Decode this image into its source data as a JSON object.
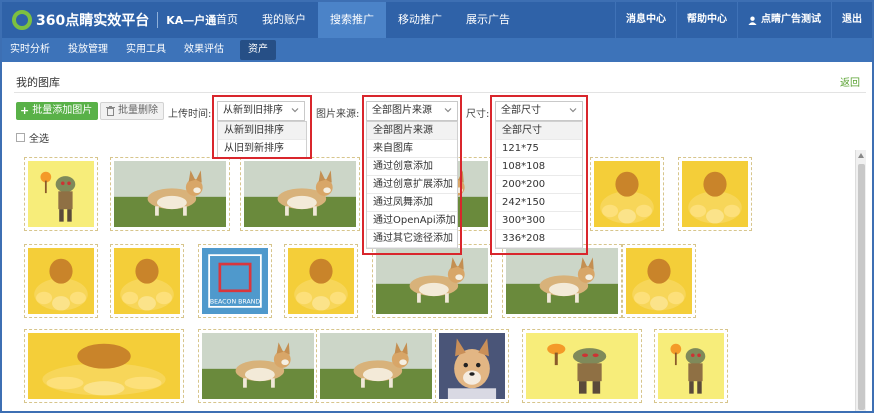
{
  "header": {
    "logo_text": "360点睛实效平台",
    "product": "KA—户通",
    "nav": [
      "首页",
      "我的账户",
      "搜索推广",
      "移动推广",
      "展示广告"
    ],
    "active_nav": "搜索推广",
    "right_nav": [
      "消息中心",
      "帮助中心",
      "点睛广告测试",
      "退出"
    ]
  },
  "subnav": {
    "items": [
      "实时分析",
      "投放管理",
      "实用工具",
      "效果评估",
      "资产"
    ],
    "active": "资产"
  },
  "page": {
    "title": "我的图库",
    "back_label": "返回"
  },
  "toolbar": {
    "batch_add_label": "批量添加图片",
    "batch_delete_label": "批量删除",
    "upload_time_label": "上传时间:",
    "upload_time_value": "从新到旧排序",
    "source_label": "图片来源:",
    "source_value": "全部图片来源",
    "size_label": "尺寸:",
    "size_value": "全部尺寸",
    "select_all_label": "全选"
  },
  "dropdowns": {
    "upload_time_options": [
      "从新到旧排序",
      "从旧到新排序"
    ],
    "source_options": [
      "全部图片来源",
      "来自图库",
      "通过创意添加",
      "通过创意扩展添加",
      "通过凤舞添加",
      "通过OpenApi添加",
      "通过其它途径添加"
    ],
    "size_options": [
      "全部尺寸",
      "121*75",
      "108*108",
      "200*200",
      "242*150",
      "300*300",
      "336*208"
    ]
  },
  "thumbnails": [
    {
      "kind": "zombie"
    },
    {
      "kind": "dog"
    },
    {
      "kind": "dog"
    },
    {
      "kind": "dog"
    },
    {
      "kind": "dog"
    },
    {
      "kind": "chick"
    },
    {
      "kind": "chick"
    },
    {
      "kind": "chick"
    },
    {
      "kind": "chick"
    },
    {
      "kind": "logo",
      "logo_text": "BEACON BRAND"
    },
    {
      "kind": "chick"
    },
    {
      "kind": "dog"
    },
    {
      "kind": "dog"
    },
    {
      "kind": "chick"
    },
    {
      "kind": "chick"
    },
    {
      "kind": "dog"
    },
    {
      "kind": "dog"
    },
    {
      "kind": "puppy"
    },
    {
      "kind": "zombie"
    },
    {
      "kind": "zombie"
    }
  ],
  "colors": {
    "header": "#2f62a8",
    "subnav": "#3d73b9",
    "accent_green": "#59b148",
    "highlight_red": "#d9262c"
  }
}
